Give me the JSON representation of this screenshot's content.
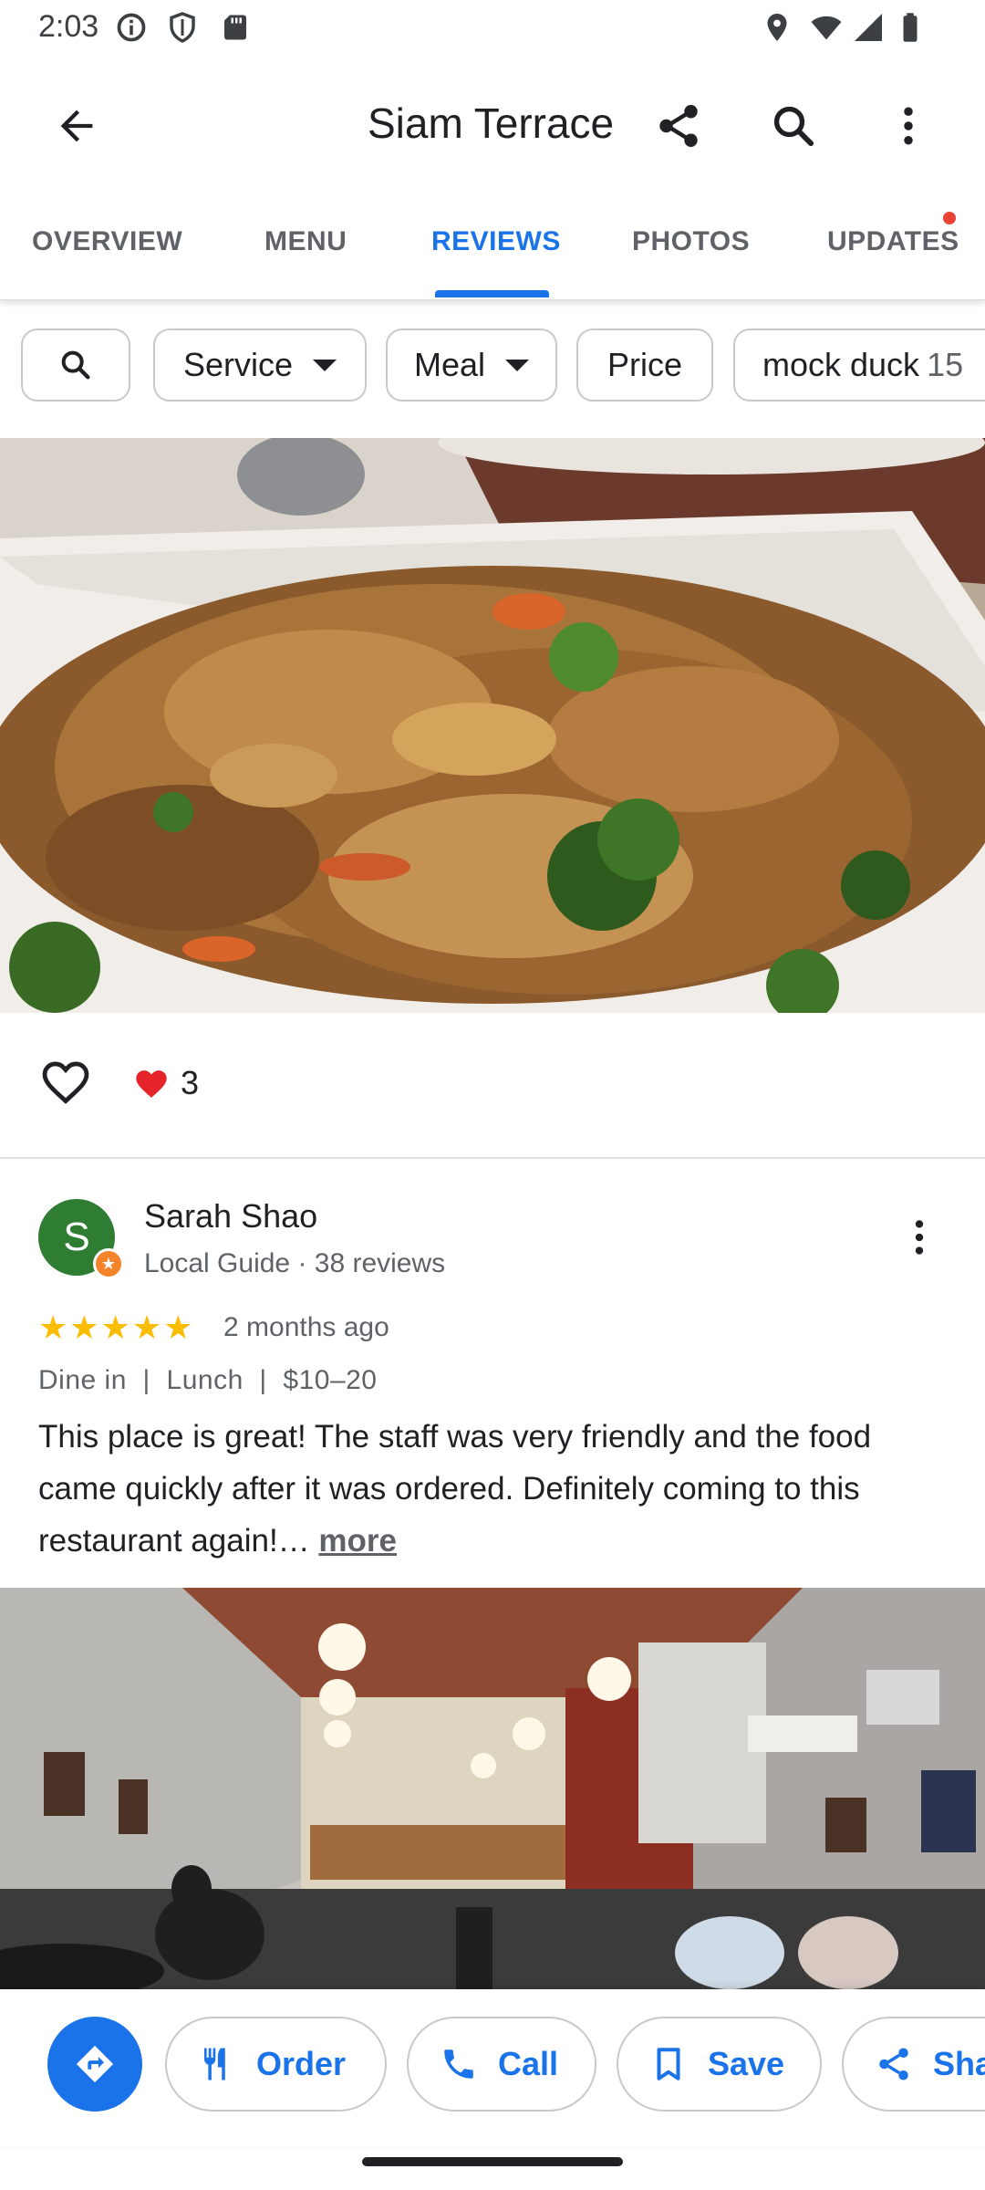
{
  "status_bar": {
    "time": "2:03"
  },
  "header": {
    "title": "Siam Terrace"
  },
  "tabs": [
    {
      "label": "OVERVIEW"
    },
    {
      "label": "MENU"
    },
    {
      "label": "REVIEWS"
    },
    {
      "label": "PHOTOS"
    },
    {
      "label": "UPDATES"
    }
  ],
  "active_tab": "REVIEWS",
  "filters": {
    "service": "Service",
    "meal": "Meal",
    "price": "Price",
    "topic": "mock duck",
    "topic_count": "15"
  },
  "reactions": {
    "count": "3"
  },
  "review": {
    "avatar_initial": "S",
    "author": "Sarah Shao",
    "meta": "Local Guide · 38 reviews",
    "stars_display": "★★★★★",
    "rating": 5,
    "date": "2 months ago",
    "tags": "Dine in  |  Lunch  |  $10–20",
    "text": "This place is great! The staff was very friendly and the food came quickly after it was ordered. Definitely coming to this restaurant again!… ",
    "more": "more"
  },
  "actions": {
    "order": "Order",
    "call": "Call",
    "save": "Save",
    "share": "Share"
  },
  "colors": {
    "accent": "#1a73e8",
    "star": "#fbbc04",
    "avatar": "#2e7d32",
    "badge": "#ea4335"
  }
}
